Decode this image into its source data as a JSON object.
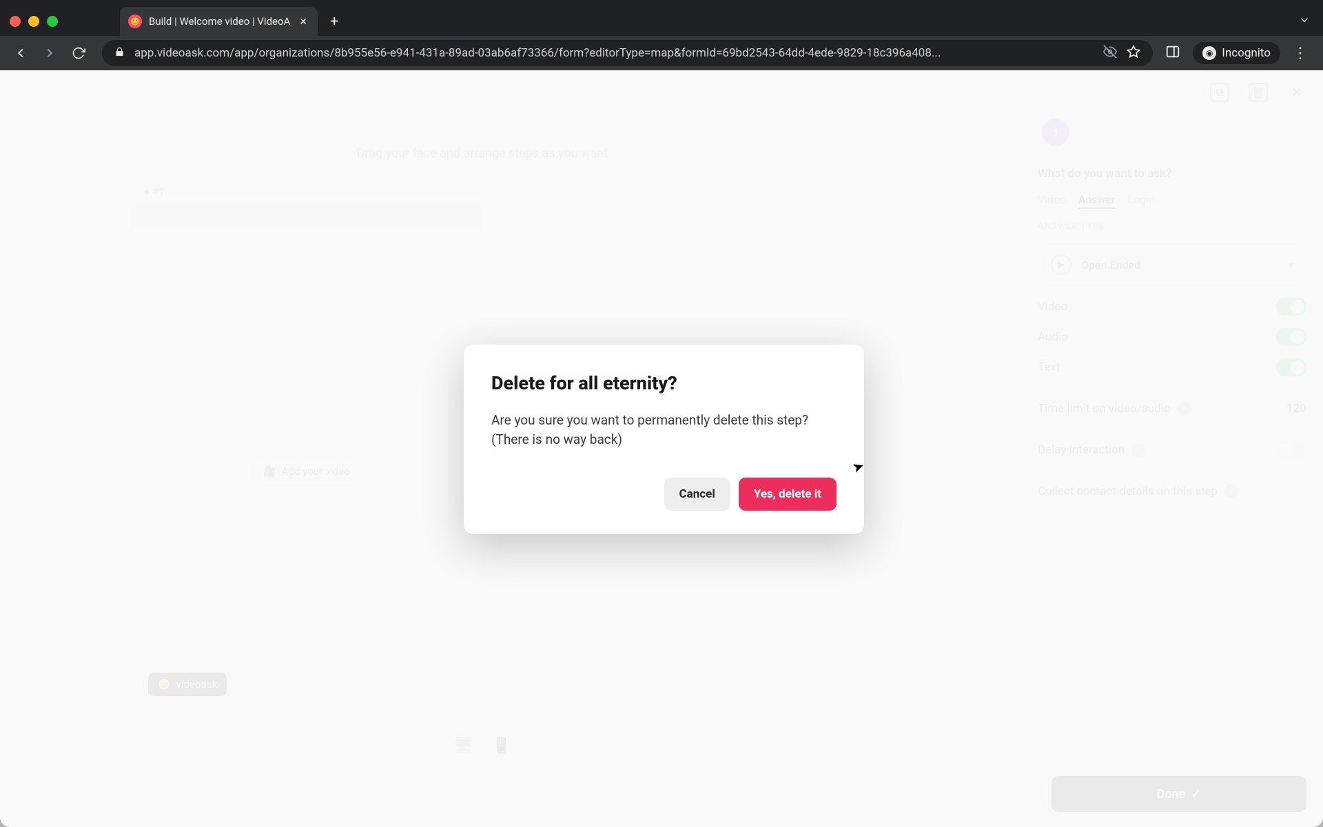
{
  "browser": {
    "tab_title": "Build | Welcome video | VideoA",
    "url_display": "app.videoask.com/app/organizations/8b955e56-e941-431a-89ad-03ab6af73366/form?editorType=map&formId=69bd2543-64dd-4ede-9829-18c396a408...",
    "incognito_label": "Incognito"
  },
  "app": {
    "canvas_hint": "Drag your face and arrange steps as you want",
    "step_label": "#1",
    "add_video_label": "Add your video",
    "brand_label": "videoask",
    "done_label": "Done"
  },
  "side": {
    "step_num": "1",
    "q_label": "What do you want to ask?",
    "tabs": {
      "video": "Video",
      "answer": "Answer",
      "logic": "Logic"
    },
    "answer_type_label": "Answer type",
    "dropdown_value": "Open Ended",
    "rows": {
      "video": "Video",
      "audio": "Audio",
      "text": "Text",
      "time_limit_label": "Time limit on video/audio",
      "time_limit_value": "120",
      "delay_label": "Delay interaction",
      "contact_label": "Collect contact details on this step"
    }
  },
  "modal": {
    "title": "Delete for all eternity?",
    "body_line1": "Are you sure you want to permanently delete this step?",
    "body_line2": "(There is no way back)",
    "cancel_label": "Cancel",
    "confirm_label": "Yes, delete it"
  }
}
